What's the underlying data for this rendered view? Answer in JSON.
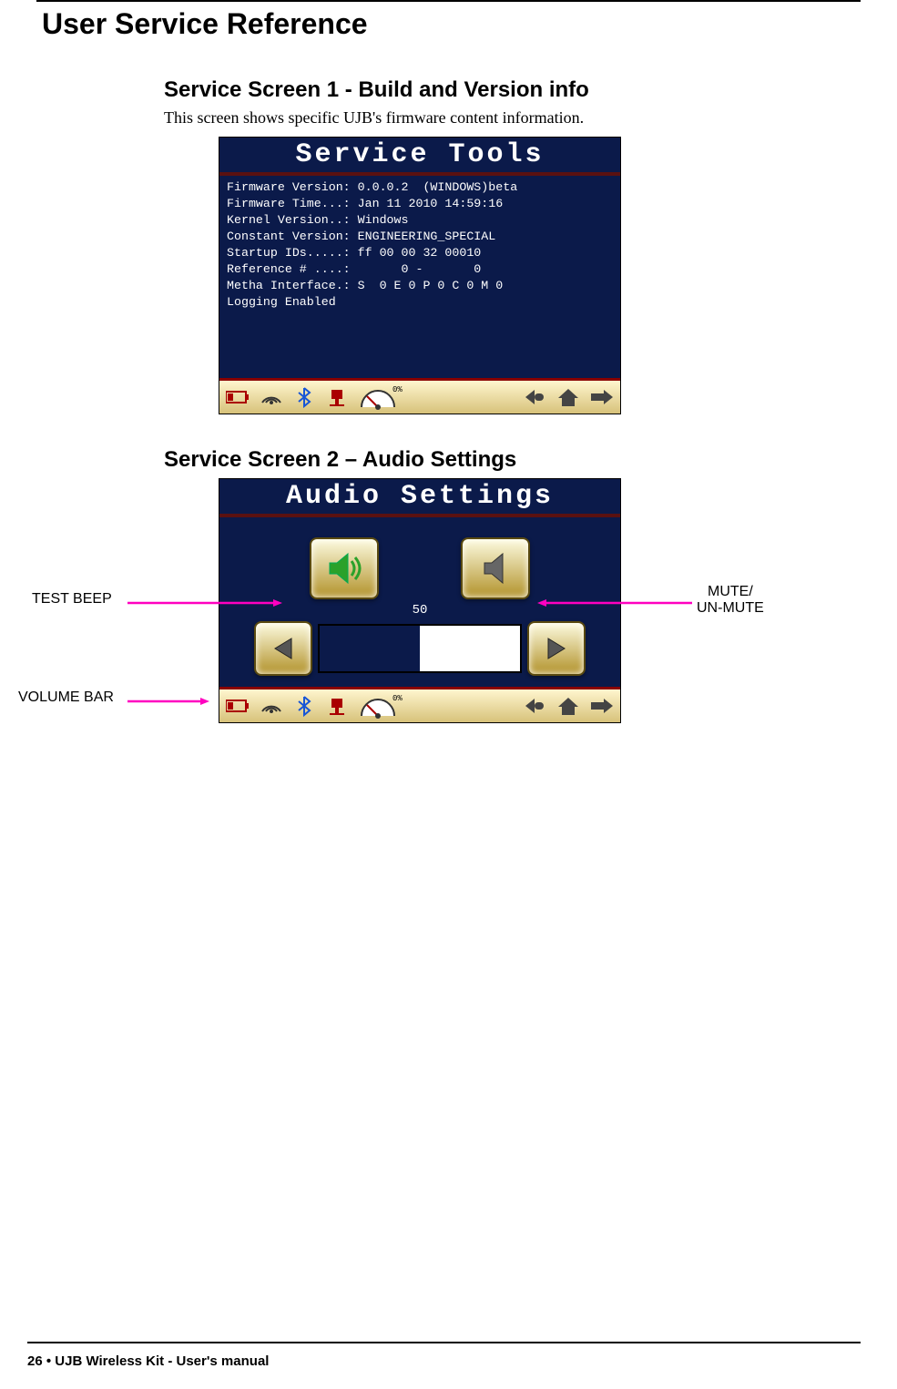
{
  "page": {
    "title": "User Service Reference",
    "footer": "26 •  UJB Wireless Kit - User's manual"
  },
  "sections": {
    "s1": {
      "heading": "Service Screen 1 - Build and Version info",
      "body": "This screen shows specific UJB's firmware content information."
    },
    "s2": {
      "heading": "Service Screen 2 – Audio Settings"
    }
  },
  "screen1": {
    "title": "Service Tools",
    "lines": "Firmware Version: 0.0.0.2  (WINDOWS)beta\nFirmware Time...: Jan 11 2010 14:59:16\nKernel Version..: Windows\nConstant Version: ENGINEERING_SPECIAL\nStartup IDs.....: ff 00 00 32 00010\nReference # ....:       0 -       0\nMetha Interface.: S  0 E 0 P 0 C 0 M 0\nLogging Enabled",
    "gauge_pct": "0%"
  },
  "screen2": {
    "title": "Audio Settings",
    "volume_value": "50",
    "gauge_pct": "0%"
  },
  "callouts": {
    "test_beep": "TEST BEEP",
    "mute": "MUTE/\nUN-MUTE",
    "volume_bar": "VOLUME BAR"
  },
  "icons": {
    "battery": "battery",
    "wifi": "wifi",
    "bluetooth": "bluetooth",
    "connector": "connector",
    "gauge": "gauge",
    "back": "back",
    "home": "home",
    "arrow": "arrow"
  }
}
